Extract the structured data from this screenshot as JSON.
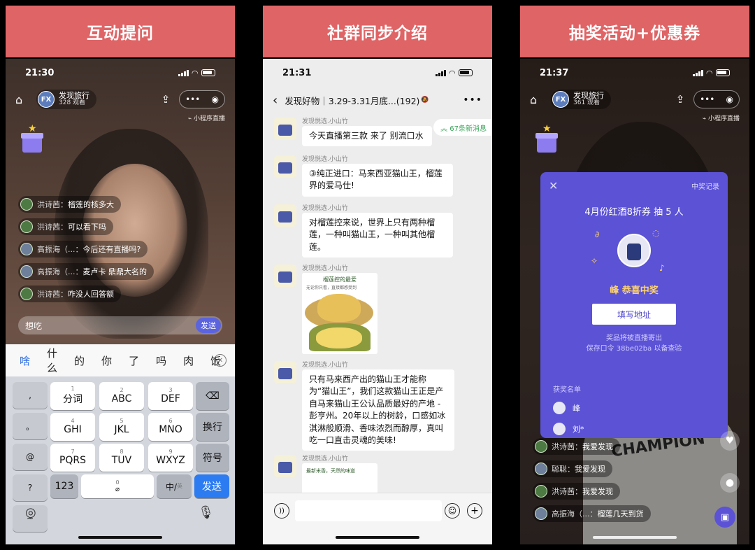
{
  "banners": [
    "互动提问",
    "社群同步介绍",
    "抽奖活动+优惠券"
  ],
  "colors": {
    "banner": "#df6466",
    "accent": "#5b52d6",
    "keyboard_send": "#2d7bf0",
    "new_msg": "#3aa55a"
  },
  "screen1": {
    "time": "21:30",
    "host_logo": "FX",
    "host_name": "发现旅行",
    "host_viewers": "328 观看",
    "mini_label": "小程序直播",
    "comments": [
      {
        "user": "洪诗茜：",
        "text": "榴莲的核多大"
      },
      {
        "user": "洪诗茜：",
        "text": "可以看下吗"
      },
      {
        "user": "高振海（...：",
        "text": "今后还有直播吗?"
      },
      {
        "user": "高振海（...：",
        "text": "麦卢卡 鼎鼎大名的"
      },
      {
        "user": "洪诗茜：",
        "text": "咋没人回答额"
      }
    ],
    "input_text": "想吃",
    "send_label": "发送",
    "candidates": [
      "啥",
      "什么",
      "的",
      "你",
      "了",
      "吗",
      "肉",
      "饭"
    ],
    "keys": {
      "row1": [
        {
          "n": "1",
          "l": "分词"
        },
        {
          "n": "2",
          "l": "ABC"
        },
        {
          "n": "3",
          "l": "DEF"
        }
      ],
      "row2": [
        {
          "n": "4",
          "l": "GHI"
        },
        {
          "n": "5",
          "l": "JKL"
        },
        {
          "n": "6",
          "l": "MNO"
        }
      ],
      "row3": [
        {
          "n": "7",
          "l": "PQRS"
        },
        {
          "n": "8",
          "l": "TUV"
        },
        {
          "n": "9",
          "l": "WXYZ"
        }
      ],
      "symbols": [
        ",",
        "。",
        "@",
        "?",
        "~"
      ],
      "backspace": "⌫",
      "switch_line": "换行",
      "symbol_key": "符号",
      "numeric": "123",
      "zero": "0",
      "cn_en": "中/",
      "cn_en_sub": "英",
      "send": "发送"
    }
  },
  "screen2": {
    "time": "21:31",
    "title": "发现好物｜3.29-3.31月底...(192)",
    "new_messages": "︽ 67条新消息",
    "sender": "发现悦选.小山竹",
    "messages": [
      "今天直播第三款 来了 别流口水",
      "③纯正进口：马来西亚猫山王，榴莲界的爱马仕!",
      "对榴莲控来说，世界上只有两种榴莲，一种叫猫山王，一种叫其他榴莲。",
      "只有马来西产出的猫山王才能称为“猫山王”，我们这款猫山王正是产自马来猫山王公认品质最好的产地 - 彭亨州。20年以上的树龄，口感如冰淇淋般顺滑、香味浓烈而醇厚，真叫吃一口直击灵魂的美味!"
    ],
    "image_caption": "榴莲控的最爱",
    "image_sub": "无论你只看，直接都感受到",
    "image2_caption": "最新米香，天然的味道"
  },
  "screen3": {
    "time": "21:37",
    "host_logo": "FX",
    "host_name": "发现旅行",
    "host_viewers": "361 观看",
    "mini_label": "小程序直播",
    "shirt_text": "CHAMPION",
    "modal": {
      "records": "中奖记录",
      "prize": "4月份红酒8折券  抽 5 人",
      "congrats": "峰  恭喜中奖",
      "address_btn": "填写地址",
      "note1": "奖品将被直播寄出",
      "note2": "保存口令 38be02ba 以备查验",
      "list_label": "获奖名单",
      "winners": [
        "峰",
        "刘*"
      ]
    },
    "comments": [
      {
        "user": "洪诗茜：",
        "text": "我爱发现"
      },
      {
        "user": "聪聪：",
        "text": "我爱发现"
      },
      {
        "user": "洪诗茜：",
        "text": "我爱发现"
      },
      {
        "user": "高振海（...：",
        "text": "榴莲几天到货"
      }
    ]
  }
}
